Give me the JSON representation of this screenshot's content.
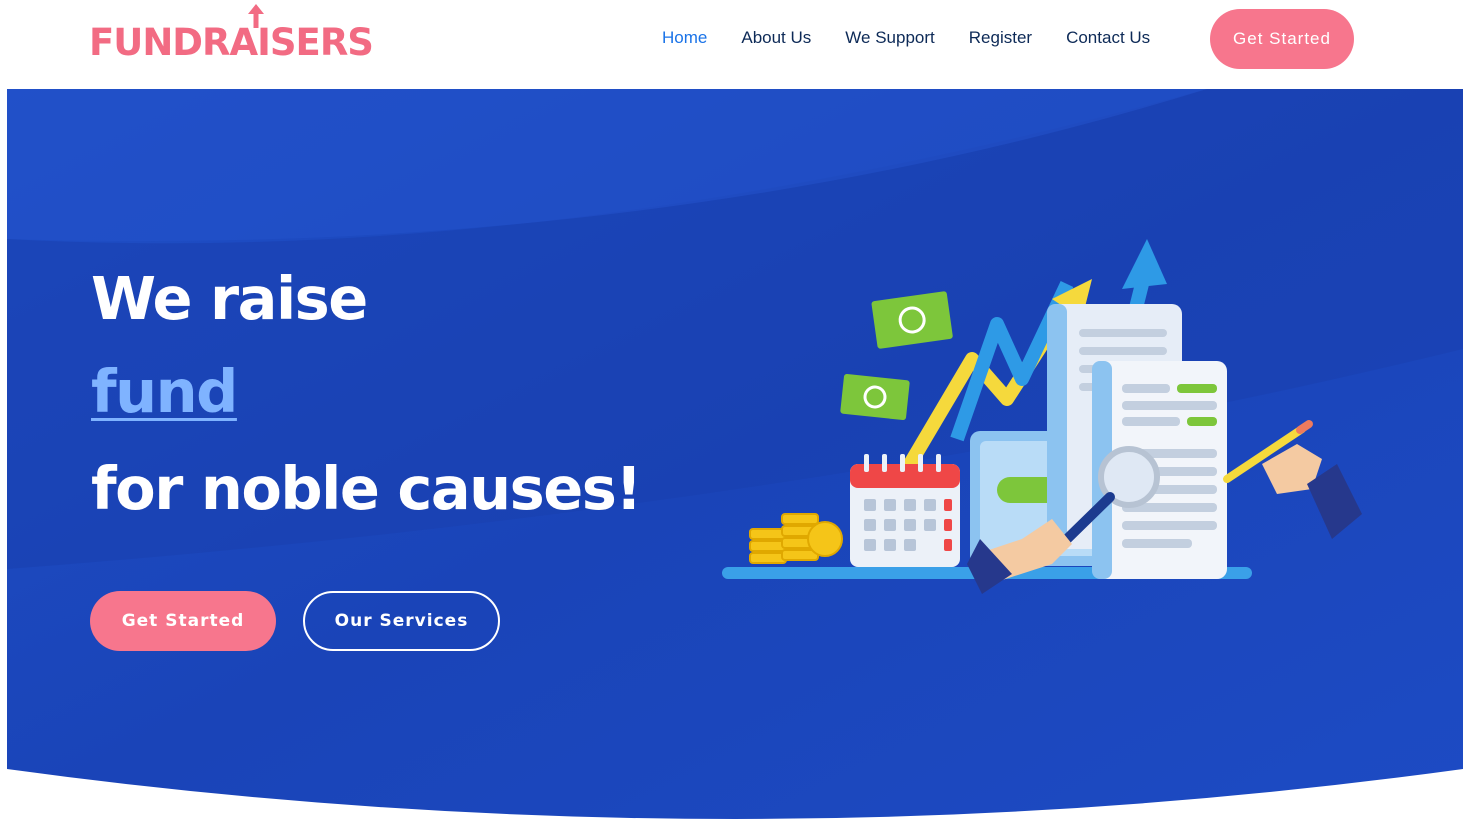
{
  "brand": {
    "logo_text": "FUNDRAISERS",
    "color": "#f26b83"
  },
  "nav": {
    "items": [
      {
        "label": "Home",
        "active": true
      },
      {
        "label": "About Us",
        "active": false
      },
      {
        "label": "We Support",
        "active": false
      },
      {
        "label": "Register",
        "active": false
      },
      {
        "label": "Contact Us",
        "active": false
      }
    ],
    "cta_label": "Get Started"
  },
  "hero": {
    "line1": "We raise",
    "line2": "fund",
    "line3": "for noble causes!",
    "primary_button": "Get Started",
    "secondary_button": "Our Services",
    "illustration_icon": "finance-growth-illustration"
  },
  "colors": {
    "accent": "#f7768d",
    "hero_blue": "#1c46bd",
    "nav_active": "#1a73e8",
    "nav_text": "#0d2a57",
    "highlight_text": "#7fb3ff"
  }
}
